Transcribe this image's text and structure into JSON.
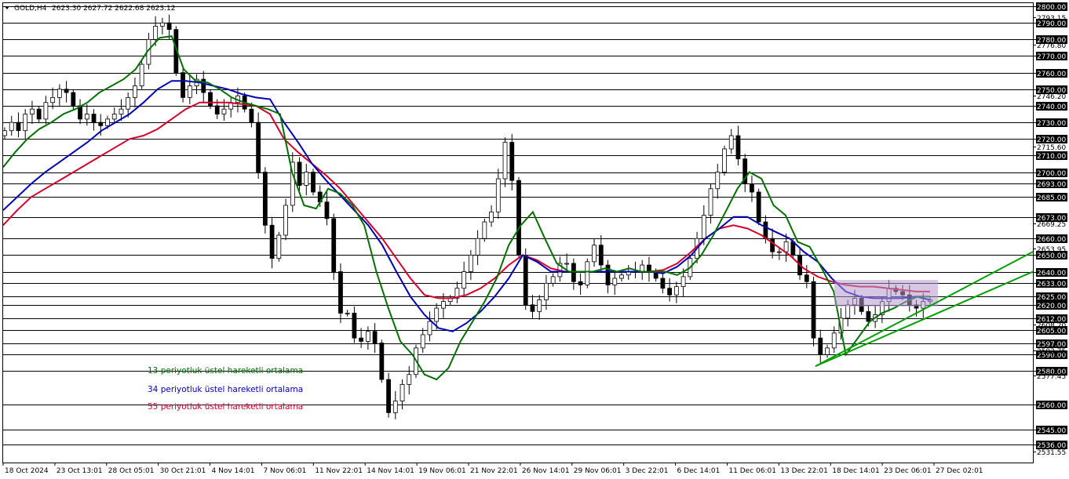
{
  "header": {
    "symbol": "GOLD,H4",
    "ohlc": "2623.30 2627.72 2622.68 2623.12"
  },
  "legend": [
    {
      "label": "13 periyotluk üstel hareketli ortalama",
      "color": "#007000"
    },
    {
      "label": "34 periyotluk üstel hareketli ortalama",
      "color": "#0000b4"
    },
    {
      "label": "55 periyotluk üstel hareketli ortalama",
      "color": "#d2002c"
    }
  ],
  "chart_data": {
    "type": "line",
    "title": "",
    "xlabel": "",
    "ylabel": "",
    "grid": "horizontal",
    "ylim": [
      2531.55,
      2800.0
    ],
    "x_tick_labels": [
      "18 Oct 2024",
      "23 Oct 13:01",
      "28 Oct 05:01",
      "30 Oct 21:01",
      "4 Nov 14:01",
      "7 Nov 06:01",
      "11 Nov 22:01",
      "14 Nov 14:01",
      "19 Nov 06:01",
      "21 Nov 22:01",
      "26 Nov 14:01",
      "29 Nov 06:01",
      "3 Dec 22:01",
      "6 Dec 14:01",
      "11 Dec 06:01",
      "13 Dec 22:01",
      "18 Dec 14:01",
      "23 Dec 06:01",
      "27 Dec 02:01"
    ],
    "y_tick_labels": [
      2800.0,
      2793.15,
      2790.0,
      2780.0,
      2776.8,
      2770.0,
      2760.0,
      2750.0,
      2746.2,
      2740.0,
      2730.0,
      2720.0,
      2715.6,
      2710.0,
      2700.0,
      2693.0,
      2685.0,
      2673.0,
      2669.25,
      2660.0,
      2653.95,
      2650.0,
      2640.0,
      2633.0,
      2625.0,
      2620.0,
      2612.0,
      2608.2,
      2605.0,
      2597.0,
      2592.75,
      2590.0,
      2580.0,
      2577.45,
      2560.0,
      2545.0,
      2536.0,
      2531.55
    ],
    "price_boxes": [
      {
        "price": 2800.0,
        "text": "2800.00"
      },
      {
        "price": 2790.0,
        "text": "2790.00"
      },
      {
        "price": 2780.0,
        "text": "2780.00"
      },
      {
        "price": 2770.0,
        "text": "2770.00"
      },
      {
        "price": 2760.0,
        "text": "2760.00"
      },
      {
        "price": 2750.0,
        "text": "2750.00"
      },
      {
        "price": 2740.0,
        "text": "2740.00"
      },
      {
        "price": 2730.0,
        "text": "2730.00"
      },
      {
        "price": 2720.0,
        "text": "2720.00"
      },
      {
        "price": 2710.0,
        "text": "2710.00"
      },
      {
        "price": 2700.0,
        "text": "2700.00"
      },
      {
        "price": 2693.0,
        "text": "2693.00"
      },
      {
        "price": 2685.0,
        "text": "2685.00"
      },
      {
        "price": 2673.0,
        "text": "2673.00"
      },
      {
        "price": 2660.0,
        "text": "2660.00"
      },
      {
        "price": 2650.0,
        "text": "2650.00"
      },
      {
        "price": 2640.0,
        "text": "2640.00"
      },
      {
        "price": 2633.0,
        "text": "2633.00"
      },
      {
        "price": 2625.0,
        "text": "2625.00"
      },
      {
        "price": 2620.0,
        "text": "2620.00"
      },
      {
        "price": 2612.0,
        "text": "2612.00"
      },
      {
        "price": 2605.0,
        "text": "2605.00"
      },
      {
        "price": 2597.0,
        "text": "2597.00"
      },
      {
        "price": 2590.0,
        "text": "2590.00"
      },
      {
        "price": 2580.0,
        "text": "2580.00"
      },
      {
        "price": 2560.0,
        "text": "2560.00"
      },
      {
        "price": 2545.0,
        "text": "2545.00"
      },
      {
        "price": 2536.0,
        "text": "2536.00"
      }
    ],
    "small_labels": [
      {
        "price": 2793.15,
        "text": "2793.15"
      },
      {
        "price": 2776.8,
        "text": "2776.80"
      },
      {
        "price": 2746.2,
        "text": "2746.20"
      },
      {
        "price": 2715.6,
        "text": "2715.60"
      },
      {
        "price": 2669.25,
        "text": "2669.25"
      },
      {
        "price": 2653.95,
        "text": "2653.95"
      },
      {
        "price": 2608.2,
        "text": "2608.20"
      },
      {
        "price": 2592.75,
        "text": "2592.75"
      },
      {
        "price": 2577.45,
        "text": "2577.45"
      },
      {
        "price": 2531.55,
        "text": "2531.55"
      }
    ],
    "close": [
      2725,
      2730,
      2725,
      2735,
      2738,
      2732,
      2742,
      2745,
      2750,
      2748,
      2740,
      2732,
      2735,
      2730,
      2728,
      2732,
      2735,
      2738,
      2745,
      2752,
      2765,
      2780,
      2788,
      2790,
      2786,
      2760,
      2745,
      2752,
      2756,
      2748,
      2740,
      2735,
      2738,
      2742,
      2746,
      2738,
      2730,
      2700,
      2668,
      2648,
      2662,
      2680,
      2706,
      2692,
      2700,
      2688,
      2682,
      2672,
      2640,
      2615,
      2615,
      2600,
      2598,
      2604,
      2597,
      2575,
      2555,
      2562,
      2572,
      2578,
      2594,
      2602,
      2610,
      2618,
      2622,
      2624,
      2630,
      2640,
      2650,
      2660,
      2670,
      2676,
      2696,
      2718,
      2695,
      2650,
      2620,
      2616,
      2623,
      2633,
      2637,
      2645,
      2645,
      2634,
      2632,
      2646,
      2656,
      2644,
      2632,
      2636,
      2638,
      2640,
      2640,
      2644,
      2640,
      2636,
      2630,
      2626,
      2631,
      2637,
      2648,
      2660,
      2674,
      2690,
      2700,
      2714,
      2722,
      2708,
      2693,
      2688,
      2670,
      2660,
      2652,
      2652,
      2658,
      2650,
      2638,
      2634,
      2600,
      2590,
      2594,
      2603,
      2612,
      2620,
      2624,
      2616,
      2610,
      2614,
      2622,
      2630,
      2628,
      2626,
      2620,
      2618,
      2622,
      2623
    ],
    "ema13": [
      2703,
      2712,
      2720,
      2726,
      2730,
      2735,
      2738,
      2742,
      2748,
      2752,
      2756,
      2762,
      2773,
      2781,
      2782,
      2762,
      2755,
      2754,
      2750,
      2745,
      2742,
      2740,
      2738,
      2735,
      2700,
      2680,
      2678,
      2690,
      2687,
      2680,
      2668,
      2640,
      2618,
      2598,
      2590,
      2578,
      2575,
      2582,
      2598,
      2610,
      2622,
      2636,
      2656,
      2668,
      2676,
      2660,
      2645,
      2640,
      2640,
      2640,
      2642,
      2640,
      2642,
      2640,
      2640,
      2640,
      2638,
      2642,
      2650,
      2662,
      2676,
      2690,
      2700,
      2696,
      2680,
      2674,
      2658,
      2655,
      2642,
      2628,
      2590,
      2600,
      2610,
      2615,
      2618,
      2622,
      2625,
      2625
    ],
    "ema34": [
      2677,
      2685,
      2693,
      2700,
      2706,
      2712,
      2718,
      2725,
      2730,
      2735,
      2742,
      2750,
      2755,
      2755,
      2754,
      2752,
      2750,
      2747,
      2745,
      2744,
      2730,
      2718,
      2705,
      2695,
      2686,
      2677,
      2668,
      2656,
      2640,
      2625,
      2614,
      2606,
      2604,
      2609,
      2616,
      2625,
      2636,
      2650,
      2646,
      2640,
      2640,
      2640,
      2640,
      2640,
      2640,
      2640,
      2640,
      2639,
      2643,
      2650,
      2660,
      2666,
      2673,
      2673,
      2668,
      2664,
      2660,
      2652,
      2646,
      2636,
      2628,
      2625,
      2624,
      2624,
      2624,
      2625,
      2623
    ],
    "ema55": [
      2668,
      2677,
      2685,
      2690,
      2695,
      2700,
      2705,
      2710,
      2715,
      2720,
      2722,
      2726,
      2732,
      2738,
      2742,
      2742,
      2742,
      2741,
      2740,
      2735,
      2720,
      2712,
      2705,
      2698,
      2690,
      2680,
      2670,
      2660,
      2648,
      2636,
      2626,
      2624,
      2624,
      2626,
      2630,
      2636,
      2644,
      2650,
      2647,
      2642,
      2640,
      2640,
      2640,
      2640,
      2640,
      2640,
      2640,
      2641,
      2645,
      2652,
      2660,
      2666,
      2668,
      2666,
      2662,
      2656,
      2650,
      2642,
      2637,
      2634,
      2632,
      2631,
      2631,
      2630,
      2629,
      2628,
      2628
    ],
    "rectangle": {
      "price_top": 2635,
      "price_bottom": 2619
    },
    "trendlines": [
      {
        "x0_bar": 0.6,
        "y0": 2583,
        "x1_bar": 1.0,
        "y1": 2652
      },
      {
        "x0_bar": 0.6,
        "y0": 2583,
        "x1_bar": 1.0,
        "y1": 2640
      }
    ]
  }
}
